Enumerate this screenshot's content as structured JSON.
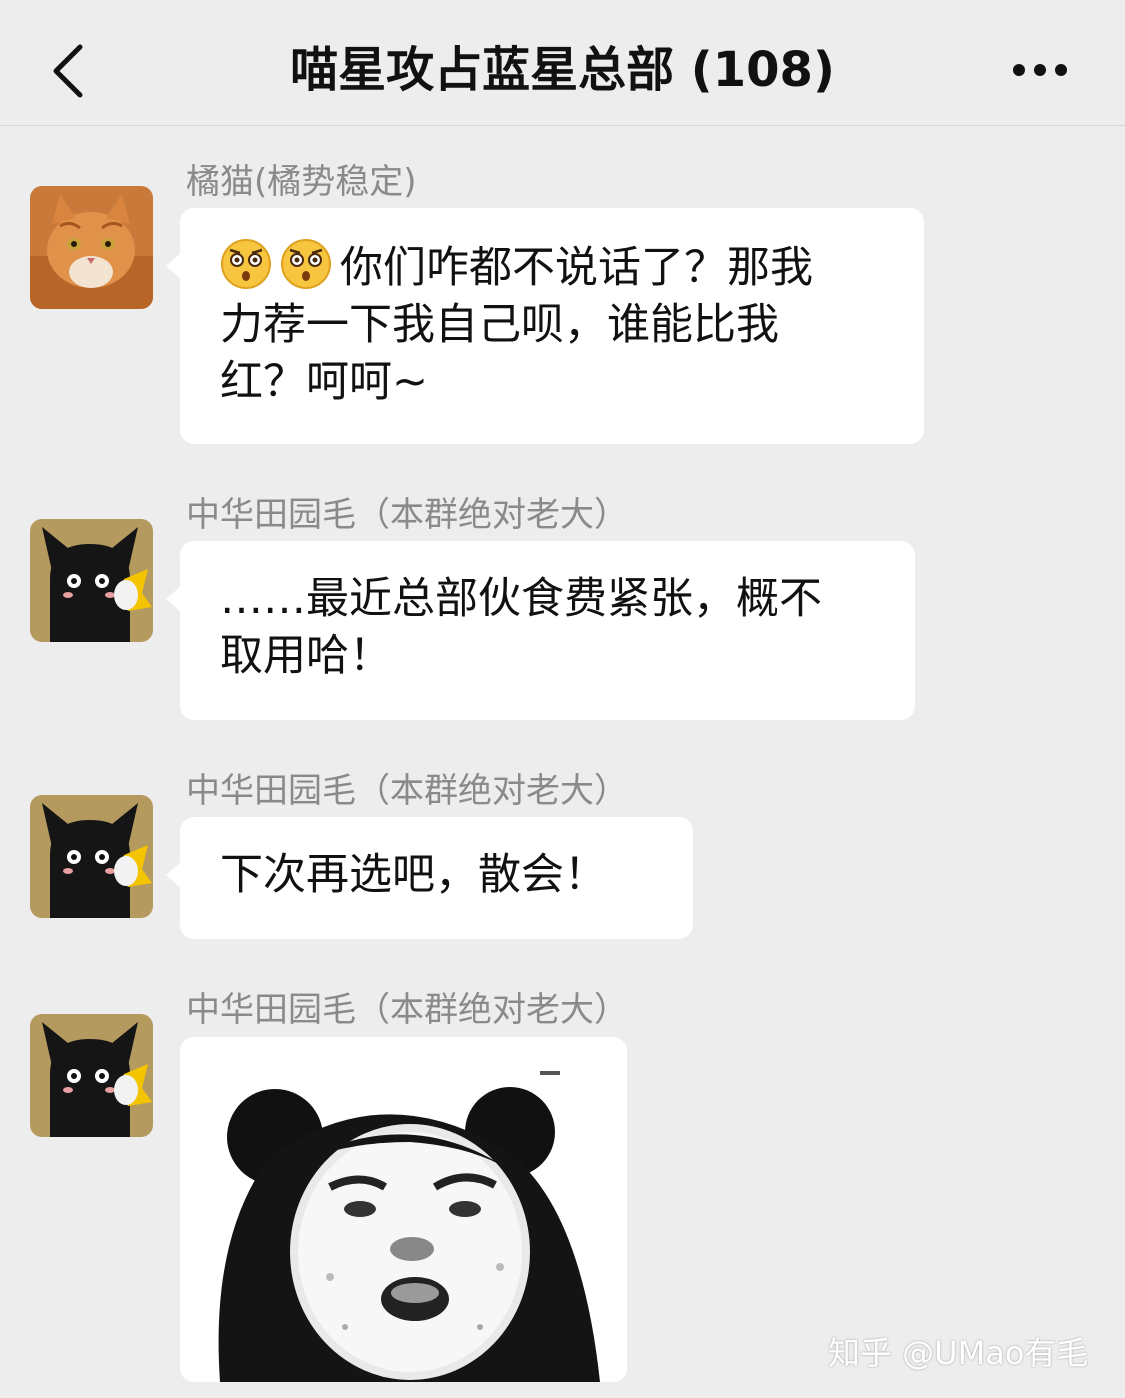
{
  "header": {
    "title": "喵星攻占蓝星总部 (108)"
  },
  "messages": [
    {
      "sender": "橘猫(橘势稳定)",
      "avatar": "orange-cat-avatar",
      "emojis": [
        "shocked-face-emoji",
        "shocked-face-emoji"
      ],
      "text_line1": "你们咋都不说话了？那我",
      "text_line2": "力荐一下我自己呗，谁能比我",
      "text_line3": "红？呵呵~"
    },
    {
      "sender": "中华田园毛（本群绝对老大）",
      "avatar": "black-cat-avatar",
      "text_line1": "……最近总部伙食费紧张，概不",
      "text_line2": "取用哈！"
    },
    {
      "sender": "中华田园毛（本群绝对老大）",
      "avatar": "black-cat-avatar",
      "text_line1": "下次再选吧，散会！"
    },
    {
      "sender": "中华田园毛（本群绝对老大）",
      "avatar": "black-cat-avatar",
      "sticker": "panda-meme-sticker"
    }
  ],
  "watermark": "知乎 @UMao有毛",
  "colors": {
    "background": "#ededed",
    "bubble": "#ffffff",
    "sender_text": "#8a8a8a",
    "avatar_tan": "#b59a5f"
  }
}
